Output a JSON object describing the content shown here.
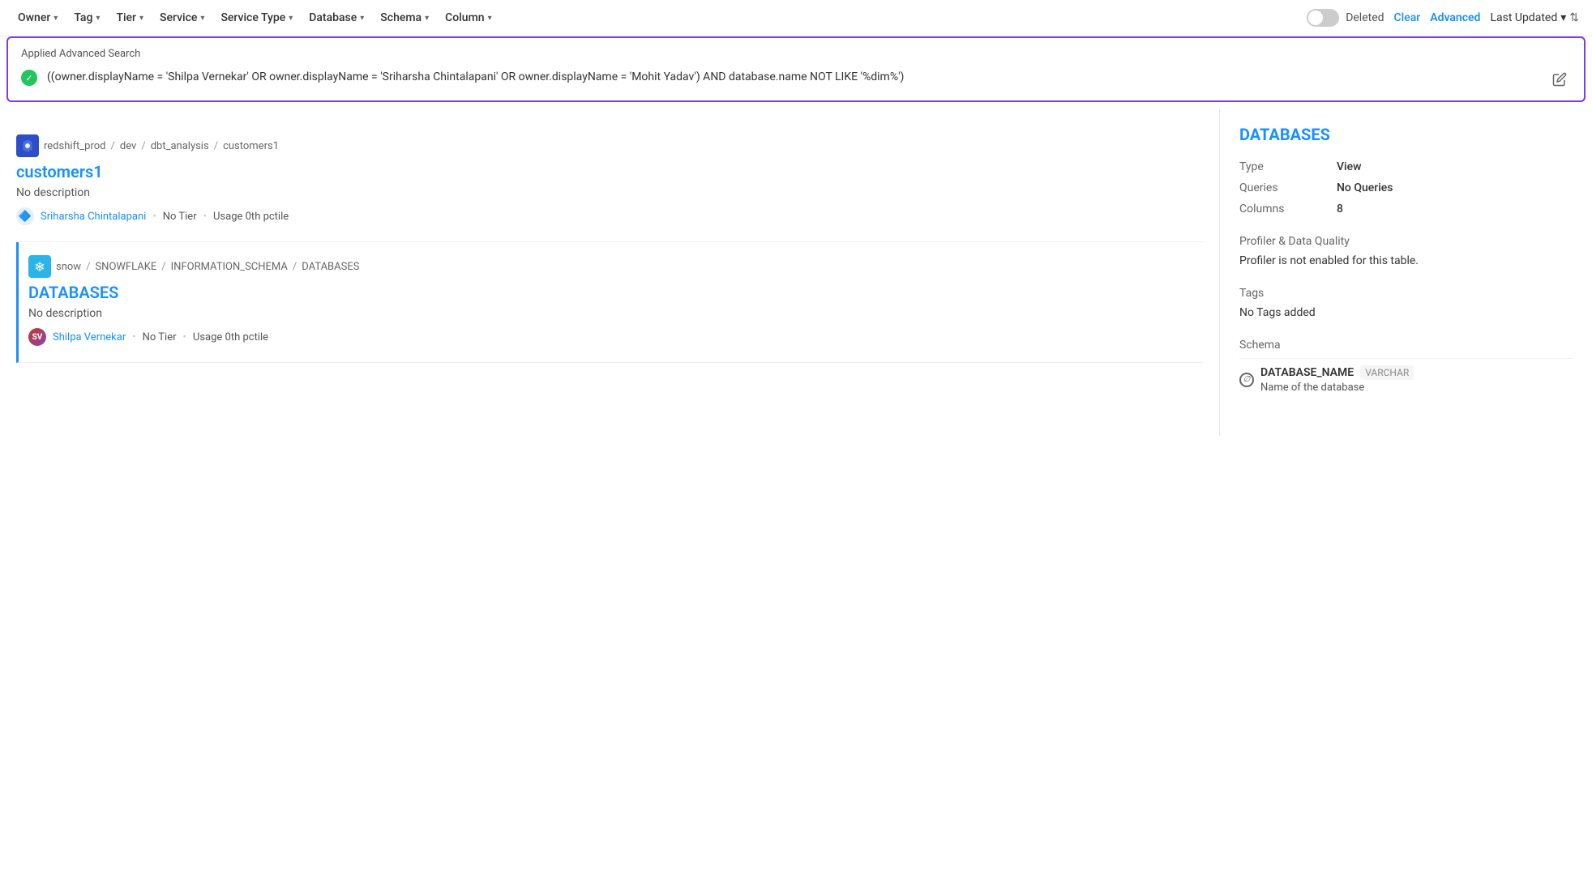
{
  "filterBar": {
    "items": [
      {
        "label": "Owner",
        "key": "owner"
      },
      {
        "label": "Tag",
        "key": "tag"
      },
      {
        "label": "Tier",
        "key": "tier"
      },
      {
        "label": "Service",
        "key": "service"
      },
      {
        "label": "Service Type",
        "key": "service-type"
      },
      {
        "label": "Database",
        "key": "database"
      },
      {
        "label": "Schema",
        "key": "schema"
      },
      {
        "label": "Column",
        "key": "column"
      }
    ],
    "deleted_label": "Deleted",
    "clear_label": "Clear",
    "advanced_label": "Advanced",
    "last_updated_label": "Last Updated"
  },
  "advancedSearch": {
    "section_label": "Applied Advanced Search",
    "query": "((owner.displayName = 'Shilpa Vernekar' OR owner.displayName = 'Sriharsha Chintalapani' OR owner.displayName = 'Mohit Yadav') AND database.name NOT LIKE '%dim%')"
  },
  "results": [
    {
      "id": "customers1",
      "service_icon": "redshift",
      "breadcrumb": [
        "redshift_prod",
        "dev",
        "dbt_analysis",
        "customers1"
      ],
      "title": "customers1",
      "description": "No description",
      "owner_name": "Sriharsha Chintalapani",
      "owner_type": "multi",
      "tier": "No Tier",
      "usage": "Usage 0th pctile"
    },
    {
      "id": "databases",
      "service_icon": "snowflake",
      "breadcrumb": [
        "snow",
        "SNOWFLAKE",
        "INFORMATION_SCHEMA",
        "DATABASES"
      ],
      "title": "DATABASES",
      "description": "No description",
      "owner_name": "Shilpa Vernekar",
      "owner_type": "person",
      "tier": "No Tier",
      "usage": "Usage 0th pctile",
      "selected": true
    }
  ],
  "rightPanel": {
    "title": "DATABASES",
    "type_label": "Type",
    "type_value": "View",
    "queries_label": "Queries",
    "queries_value": "No Queries",
    "columns_label": "Columns",
    "columns_value": "8",
    "profiler_section_title": "Profiler & Data Quality",
    "profiler_text": "Profiler is not enabled for this table.",
    "tags_section_title": "Tags",
    "tags_text": "No Tags added",
    "schema_section_title": "Schema",
    "schema_columns": [
      {
        "null_icon": "∅",
        "name": "DATABASE_NAME",
        "type": "VARCHAR",
        "description": "Name of the database"
      }
    ]
  }
}
